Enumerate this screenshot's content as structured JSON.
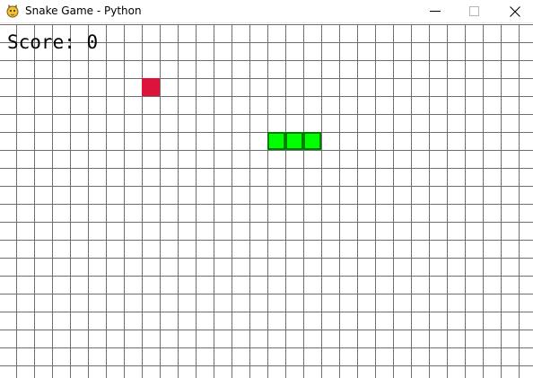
{
  "window": {
    "title": "Snake Game - Python",
    "app_icon": "python-snake-icon",
    "controls": {
      "minimize": "minimize-icon",
      "maximize": "maximize-icon",
      "close": "close-icon"
    }
  },
  "game": {
    "score_label": "Score: 0",
    "grid": {
      "columns": 30,
      "rows": 20,
      "line_color": "#6f6f6f",
      "background": "#ffffff"
    },
    "food": {
      "col": 8,
      "row": 3,
      "color": "#dc143c"
    },
    "snake": {
      "color": "#00ff00",
      "outline_color": "#008000",
      "segments": [
        {
          "col": 15,
          "row": 6
        },
        {
          "col": 16,
          "row": 6
        },
        {
          "col": 17,
          "row": 6
        }
      ]
    }
  }
}
